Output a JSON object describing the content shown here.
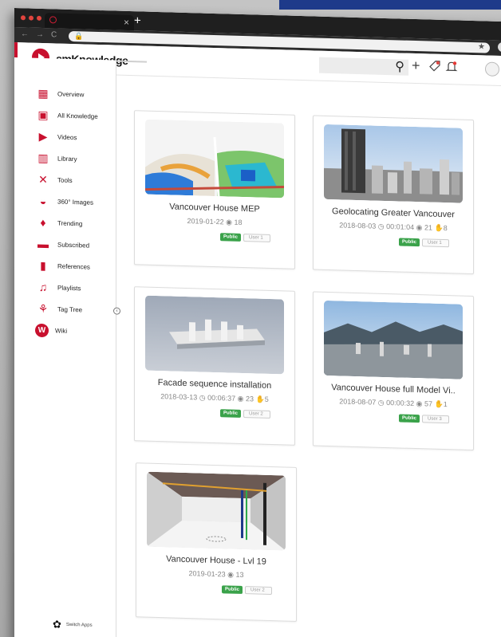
{
  "browser": {
    "tab_close": "×",
    "new_tab": "+",
    "nav_icons": [
      "←",
      "→",
      "C"
    ],
    "url_lock": "🔒",
    "url_star": "★"
  },
  "app": {
    "brand": "cmKnowledge",
    "accent": "#c8102e",
    "search_icon": "⚲",
    "add_icon": "+",
    "header_icons": [
      "tag-icon",
      "bell-icon"
    ]
  },
  "sidebar": {
    "items": [
      {
        "label": "Overview",
        "icon": "overview-icon",
        "glyph": "▦"
      },
      {
        "label": "All Knowledge",
        "icon": "knowledge-icon",
        "glyph": "▣"
      },
      {
        "label": "Videos",
        "icon": "video-icon",
        "glyph": "▶"
      },
      {
        "label": "Library",
        "icon": "library-icon",
        "glyph": "▥"
      },
      {
        "label": "Tools",
        "icon": "tools-icon",
        "glyph": "✕"
      },
      {
        "label": "360° Images",
        "icon": "panorama-icon",
        "glyph": "◒"
      },
      {
        "label": "Trending",
        "icon": "flame-icon",
        "glyph": "♦"
      },
      {
        "label": "Subscribed",
        "icon": "subscribe-icon",
        "glyph": "▬"
      },
      {
        "label": "References",
        "icon": "bookmark-icon",
        "glyph": "▮"
      },
      {
        "label": "Playlists",
        "icon": "playlist-icon",
        "glyph": "♫"
      },
      {
        "label": "Tag Tree",
        "icon": "tag-tree-icon",
        "glyph": "⚘"
      },
      {
        "label": "Wiki",
        "icon": "wiki-icon",
        "glyph": "W"
      }
    ],
    "collapse_glyph": "‹",
    "switch_apps": "Switch Apps"
  },
  "cards": [
    {
      "title": "Vancouver House MEP",
      "meta": "2019-01-22 ◉ 18",
      "badge": "Public",
      "user": "User 1",
      "thumb": "mep"
    },
    {
      "title": "Geolocating Greater Vancouver",
      "meta": "2018-08-03 ◷ 00:01:04 ◉ 21 ✋8",
      "badge": "Public",
      "user": "User 1",
      "thumb": "city"
    },
    {
      "title": "Facade sequence installation",
      "meta": "2018-03-13 ◷ 00:06:37 ◉ 23 ✋5",
      "badge": "Public",
      "user": "User 2",
      "thumb": "facade"
    },
    {
      "title": "Vancouver House full Model Vi..",
      "meta": "2018-08-07 ◷ 00:00:32 ◉ 57 ✋1",
      "badge": "Public",
      "user": "User 3",
      "thumb": "model"
    },
    {
      "title": "Vancouver House - Lvl 19",
      "meta": "2019-01-23 ◉ 13",
      "badge": "Public",
      "user": "User 2",
      "thumb": "lvl19"
    }
  ]
}
